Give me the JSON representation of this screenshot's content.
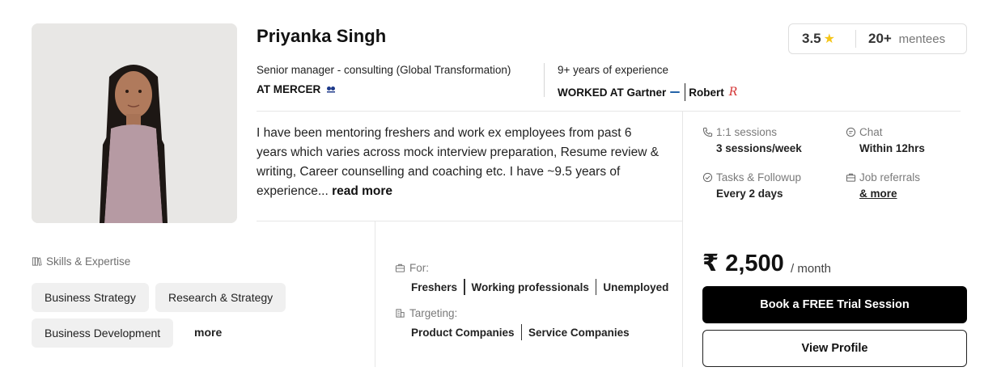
{
  "mentor": {
    "name": "Priyanka Singh",
    "role": "Senior manager - consulting (Global Transformation)",
    "company": "AT MERCER",
    "experience": "9+ years of experience",
    "worked_at_label": "WORKED AT Gartner",
    "worked_at_second": "Robert",
    "rating": "3.5",
    "mentee_count": "20+",
    "mentee_label": "mentees",
    "bio": "I have been mentoring freshers and work ex employees from past 6 years which varies across mock interview preparation, Resume review & writing, Career counselling and coaching etc. I have ~9.5 years of experience...",
    "read_more": "read more"
  },
  "features": {
    "sessions": {
      "title": "1:1 sessions",
      "value": "3 sessions/week",
      "icon": "phone-icon"
    },
    "chat": {
      "title": "Chat",
      "value": "Within 12hrs",
      "icon": "chat-icon"
    },
    "tasks": {
      "title": "Tasks & Followup",
      "value": "Every 2 days",
      "icon": "check-circle-icon"
    },
    "referrals": {
      "title": "Job referrals",
      "value": "& more",
      "icon": "briefcase-icon"
    }
  },
  "skills": {
    "title": "Skills & Expertise",
    "items": [
      "Business Strategy",
      "Research & Strategy",
      "Business Development"
    ],
    "more": "more"
  },
  "audience": {
    "for_title": "For:",
    "for_items": [
      "Freshers",
      "Working professionals",
      "Unemployed"
    ],
    "targeting_title": "Targeting:",
    "targeting_items": [
      "Product Companies",
      "Service Companies"
    ]
  },
  "pricing": {
    "price": "₹ 2,500",
    "period": "/ month",
    "book_label": "Book a FREE Trial Session",
    "view_label": "View Profile"
  },
  "colors": {
    "star": "#f5c518",
    "primary_button": "#000000",
    "chip_bg": "#f0f0f0"
  }
}
